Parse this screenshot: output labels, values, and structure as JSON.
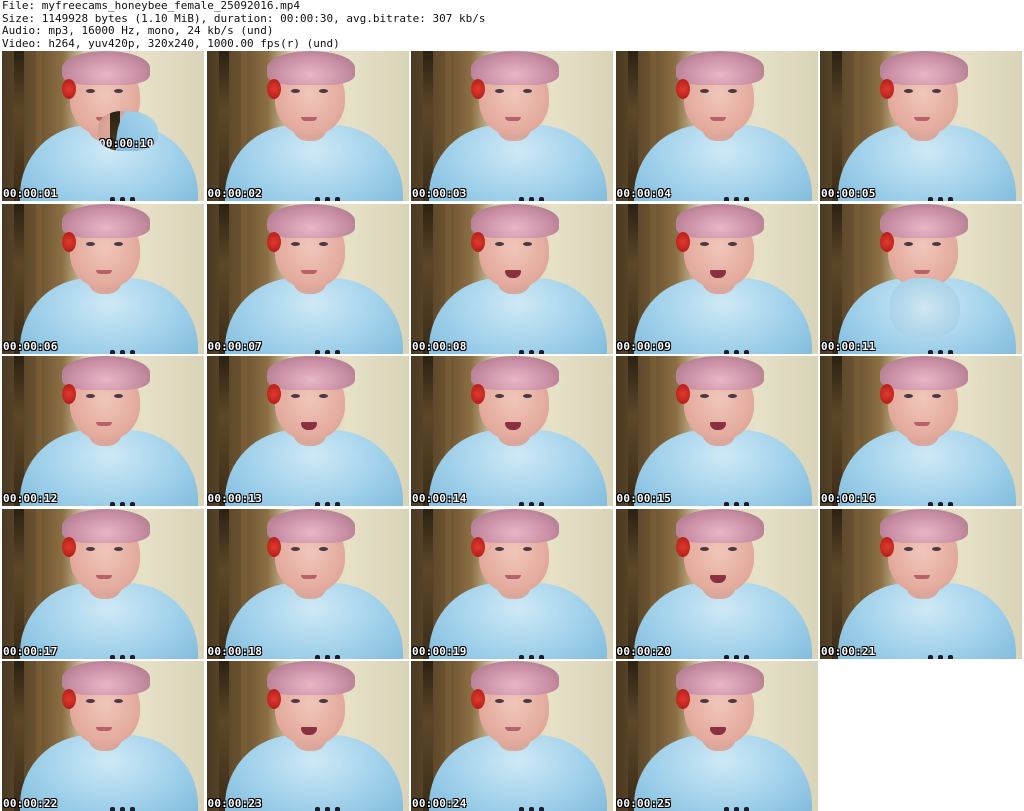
{
  "header": {
    "file_line": "File: myfreecams_honeybee_female_25092016.mp4",
    "size_line": "Size: 1149928 bytes (1.10 MiB), duration: 00:00:30, avg.bitrate: 307 kb/s",
    "audio_line": "Audio: mp3, 16000 Hz, mono, 24 kb/s (und)",
    "video_line": "Video: h264, yuv420p, 320x240, 1000.00 fps(r) (und)"
  },
  "thumbnails": [
    {
      "timestamp": "00:00:01",
      "pose": "neutral"
    },
    {
      "timestamp": "00:00:02",
      "pose": "neutral"
    },
    {
      "timestamp": "00:00:03",
      "pose": "neutral"
    },
    {
      "timestamp": "00:00:04",
      "pose": "neutral"
    },
    {
      "timestamp": "00:00:05",
      "pose": "neutral"
    },
    {
      "timestamp": "00:00:06",
      "pose": "neutral"
    },
    {
      "timestamp": "00:00:07",
      "pose": "neutral"
    },
    {
      "timestamp": "00:00:08",
      "pose": "smile"
    },
    {
      "timestamp": "00:00:09",
      "pose": "smile"
    },
    {
      "timestamp": "00:00:10",
      "pose": "hand"
    },
    {
      "timestamp": "00:00:11",
      "pose": "wave"
    },
    {
      "timestamp": "00:00:12",
      "pose": "neutral"
    },
    {
      "timestamp": "00:00:13",
      "pose": "smile"
    },
    {
      "timestamp": "00:00:14",
      "pose": "smile"
    },
    {
      "timestamp": "00:00:15",
      "pose": "smile"
    },
    {
      "timestamp": "00:00:16",
      "pose": "neutral"
    },
    {
      "timestamp": "00:00:17",
      "pose": "neutral"
    },
    {
      "timestamp": "00:00:18",
      "pose": "neutral"
    },
    {
      "timestamp": "00:00:19",
      "pose": "neutral"
    },
    {
      "timestamp": "00:00:20",
      "pose": "smile"
    },
    {
      "timestamp": "00:00:21",
      "pose": "neutral"
    },
    {
      "timestamp": "00:00:22",
      "pose": "neutral"
    },
    {
      "timestamp": "00:00:23",
      "pose": "smile"
    },
    {
      "timestamp": "00:00:24",
      "pose": "neutral"
    },
    {
      "timestamp": "00:00:25",
      "pose": "smile"
    }
  ]
}
